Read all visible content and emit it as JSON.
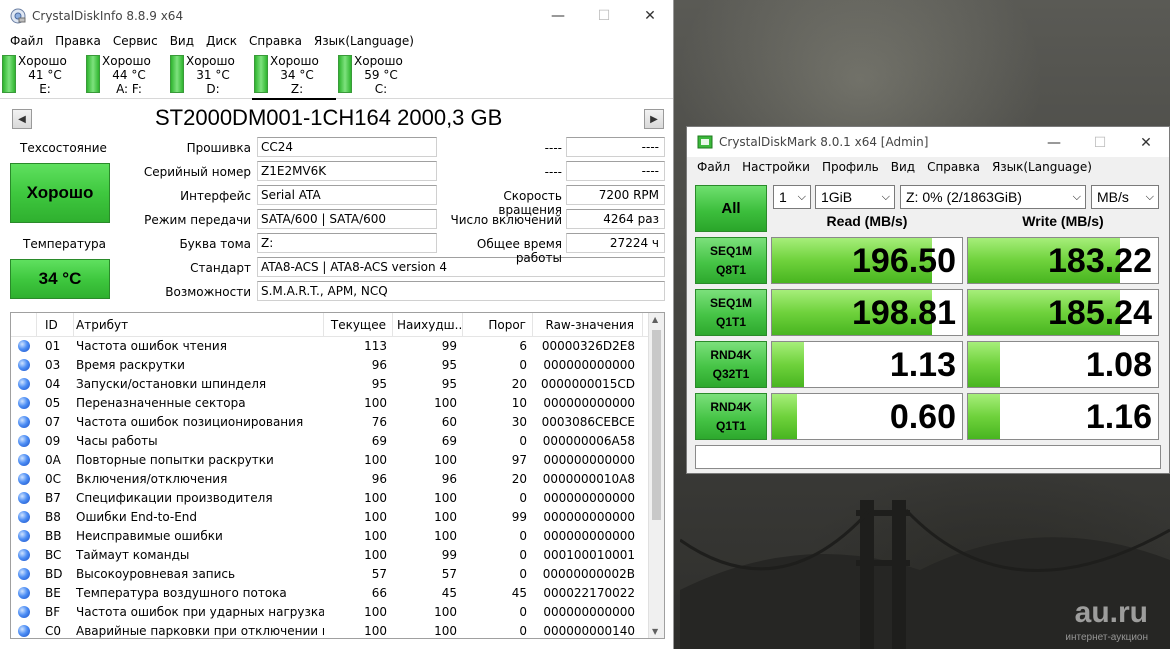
{
  "cdi": {
    "title": "CrystalDiskInfo 8.8.9 x64",
    "menu": [
      "Файл",
      "Правка",
      "Сервис",
      "Вид",
      "Диск",
      "Справка",
      "Язык(Language)"
    ],
    "drives": [
      {
        "status": "Хорошо",
        "temp": "41 °C",
        "letter": "E:"
      },
      {
        "status": "Хорошо",
        "temp": "44 °C",
        "letter": "A: F:"
      },
      {
        "status": "Хорошо",
        "temp": "31 °C",
        "letter": "D:"
      },
      {
        "status": "Хорошо",
        "temp": "34 °C",
        "letter": "Z:"
      },
      {
        "status": "Хорошо",
        "temp": "59 °C",
        "letter": "C:"
      }
    ],
    "model": "ST2000DM001-1CH164 2000,3 GB",
    "health_label": "Техсостояние",
    "health_value": "Хорошо",
    "temp_label": "Температура",
    "temp_value": "34 °C",
    "info": {
      "firmware_label": "Прошивка",
      "firmware": "CC24",
      "serial_label": "Серийный номер",
      "serial": "Z1E2MV6K",
      "interface_label": "Интерфейс",
      "interface": "Serial ATA",
      "transfer_label": "Режим передачи",
      "transfer": "SATA/600 | SATA/600",
      "letter_label": "Буква тома",
      "letter": "Z:",
      "standard_label": "Стандарт",
      "standard": "ATA8-ACS | ATA8-ACS version 4",
      "features_label": "Возможности",
      "features": "S.M.A.R.T., APM, NCQ",
      "dash1a": "----",
      "dash1b": "----",
      "dash2a": "----",
      "dash2b": "----",
      "rotation_label": "Скорость вращения",
      "rotation": "7200 RPM",
      "power_count_label": "Число включений",
      "power_count": "4264 раз",
      "power_hours_label": "Общее время работы",
      "power_hours": "27224 ч"
    },
    "smart_headers": {
      "id": "ID",
      "attr": "Атрибут",
      "cur": "Текущее",
      "worst": "Наихудш...",
      "thr": "Порог",
      "raw": "Raw-значения"
    },
    "smart": [
      {
        "id": "01",
        "attr": "Частота ошибок чтения",
        "cur": "113",
        "worst": "99",
        "thr": "6",
        "raw": "00000326D2E8"
      },
      {
        "id": "03",
        "attr": "Время раскрутки",
        "cur": "96",
        "worst": "95",
        "thr": "0",
        "raw": "000000000000"
      },
      {
        "id": "04",
        "attr": "Запуски/остановки шпинделя",
        "cur": "95",
        "worst": "95",
        "thr": "20",
        "raw": "0000000015CD"
      },
      {
        "id": "05",
        "attr": "Переназначенные сектора",
        "cur": "100",
        "worst": "100",
        "thr": "10",
        "raw": "000000000000"
      },
      {
        "id": "07",
        "attr": "Частота ошибок позиционирования",
        "cur": "76",
        "worst": "60",
        "thr": "30",
        "raw": "0003086CEBCE"
      },
      {
        "id": "09",
        "attr": "Часы работы",
        "cur": "69",
        "worst": "69",
        "thr": "0",
        "raw": "000000006A58"
      },
      {
        "id": "0A",
        "attr": "Повторные попытки раскрутки",
        "cur": "100",
        "worst": "100",
        "thr": "97",
        "raw": "000000000000"
      },
      {
        "id": "0C",
        "attr": "Включения/отключения",
        "cur": "96",
        "worst": "96",
        "thr": "20",
        "raw": "0000000010A8"
      },
      {
        "id": "B7",
        "attr": "Спецификации производителя",
        "cur": "100",
        "worst": "100",
        "thr": "0",
        "raw": "000000000000"
      },
      {
        "id": "B8",
        "attr": "Ошибки End-to-End",
        "cur": "100",
        "worst": "100",
        "thr": "99",
        "raw": "000000000000"
      },
      {
        "id": "BB",
        "attr": "Неисправимые ошибки",
        "cur": "100",
        "worst": "100",
        "thr": "0",
        "raw": "000000000000"
      },
      {
        "id": "BC",
        "attr": "Таймаут команды",
        "cur": "100",
        "worst": "99",
        "thr": "0",
        "raw": "000100010001"
      },
      {
        "id": "BD",
        "attr": "Высокоуровневая запись",
        "cur": "57",
        "worst": "57",
        "thr": "0",
        "raw": "00000000002B"
      },
      {
        "id": "BE",
        "attr": "Температура воздушного потока",
        "cur": "66",
        "worst": "45",
        "thr": "45",
        "raw": "000022170022"
      },
      {
        "id": "BF",
        "attr": "Частота ошибок при ударных нагрузках",
        "cur": "100",
        "worst": "100",
        "thr": "0",
        "raw": "000000000000"
      },
      {
        "id": "C0",
        "attr": "Аварийные парковки при отключении пи...",
        "cur": "100",
        "worst": "100",
        "thr": "0",
        "raw": "000000000140"
      }
    ]
  },
  "cdm": {
    "title": "CrystalDiskMark 8.0.1 x64 [Admin]",
    "menu": [
      "Файл",
      "Настройки",
      "Профиль",
      "Вид",
      "Справка",
      "Язык(Language)"
    ],
    "all_label": "All",
    "count": "1",
    "size": "1GiB",
    "drive": "Z: 0% (2/1863GiB)",
    "unit": "MB/s",
    "read_header": "Read (MB/s)",
    "write_header": "Write (MB/s)",
    "tests": [
      {
        "line1": "SEQ1M",
        "line2": "Q8T1",
        "read": "196.50",
        "write": "183.22",
        "read_fill": 0.84,
        "write_fill": 0.8
      },
      {
        "line1": "SEQ1M",
        "line2": "Q1T1",
        "read": "198.81",
        "write": "185.24",
        "read_fill": 0.84,
        "write_fill": 0.8
      },
      {
        "line1": "RND4K",
        "line2": "Q32T1",
        "read": "1.13",
        "write": "1.08",
        "read_fill": 0.17,
        "write_fill": 0.17
      },
      {
        "line1": "RND4K",
        "line2": "Q1T1",
        "read": "0.60",
        "write": "1.16",
        "read_fill": 0.13,
        "write_fill": 0.17
      }
    ]
  },
  "watermark": "au.ru",
  "watermark_sub": "интернет-аукцион"
}
